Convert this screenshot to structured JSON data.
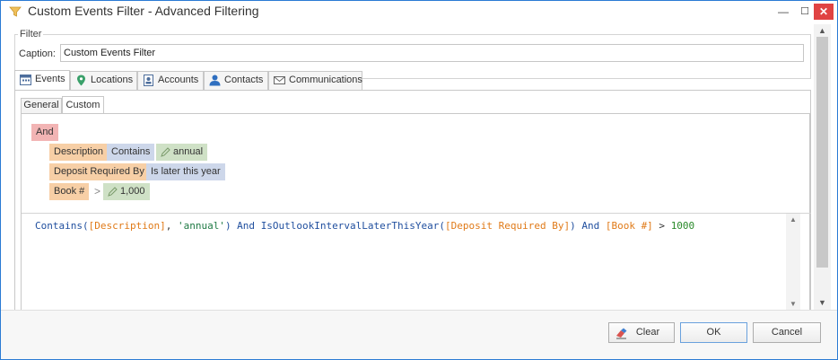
{
  "window": {
    "title": "Custom Events Filter - Advanced Filtering",
    "controls": {
      "minimize": "—",
      "maximize": "☐",
      "close": "✕"
    }
  },
  "filter_group": {
    "label": "Filter",
    "caption_label": "Caption:",
    "caption_value": "Custom Events Filter"
  },
  "tabs": [
    {
      "label": "Events",
      "icon": "calendar-icon"
    },
    {
      "label": "Locations",
      "icon": "location-pin-icon"
    },
    {
      "label": "Accounts",
      "icon": "account-card-icon"
    },
    {
      "label": "Contacts",
      "icon": "contact-person-icon"
    },
    {
      "label": "Communications",
      "icon": "envelope-icon"
    }
  ],
  "subtabs": [
    {
      "label": "General"
    },
    {
      "label": "Custom"
    }
  ],
  "condition_tree": {
    "group_operator": "And",
    "conditions": [
      {
        "field": "Description",
        "operator": "Contains",
        "value": "annual"
      },
      {
        "field": "Deposit Required By",
        "operator": "Is later this year"
      },
      {
        "field": "Book #",
        "operator": ">",
        "value": "1,000"
      }
    ]
  },
  "expression": {
    "fn1": "Contains(",
    "field1": "[Description]",
    "sep1": ", ",
    "str1": "'annual'",
    "close1": ")",
    "and1": " And ",
    "fn2": "IsOutlookIntervalLaterThisYear(",
    "field2": "[Deposit Required By]",
    "close2": ")",
    "and2": " And ",
    "field3": "[Book #]",
    "op3": " > ",
    "num3": "1000"
  },
  "colors": {
    "and_chip": "#f2b4b4",
    "field_chip": "#f7cfa6",
    "operator_chip": "#cdd7ea",
    "value_chip": "#cfe1c6",
    "window_border": "#2b7bd4"
  },
  "footer": {
    "clear_label": "Clear",
    "ok_label": "OK",
    "cancel_label": "Cancel"
  }
}
